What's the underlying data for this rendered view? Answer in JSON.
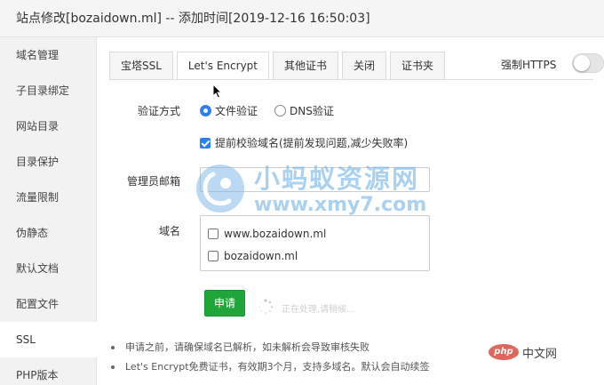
{
  "title": "站点修改[bozaidown.ml] -- 添加时间[2019-12-16 16:50:03]",
  "sidebar": {
    "items": [
      {
        "label": "域名管理"
      },
      {
        "label": "子目录绑定"
      },
      {
        "label": "网站目录"
      },
      {
        "label": "目录保护"
      },
      {
        "label": "流量限制"
      },
      {
        "label": "伪静态"
      },
      {
        "label": "默认文档"
      },
      {
        "label": "配置文件"
      },
      {
        "label": "SSL"
      },
      {
        "label": "PHP版本"
      }
    ],
    "active": "SSL"
  },
  "tabs": [
    {
      "label": "宝塔SSL"
    },
    {
      "label": "Let's Encrypt"
    },
    {
      "label": "其他证书"
    },
    {
      "label": "关闭"
    },
    {
      "label": "证书夹"
    }
  ],
  "active_tab": "Let's Encrypt",
  "force_https": {
    "label": "强制HTTPS",
    "enabled": false
  },
  "form": {
    "verify_label": "验证方式",
    "verify_options": [
      {
        "label": "文件验证",
        "selected": true
      },
      {
        "label": "DNS验证",
        "selected": false
      }
    ],
    "precheck": {
      "label": "提前校验域名(提前发现问题,减少失败率)",
      "checked": true
    },
    "email_label": "管理员邮箱",
    "email_value": "",
    "domain_label": "域名",
    "domains": [
      {
        "label": "www.bozaidown.ml",
        "checked": false
      },
      {
        "label": "bozaidown.ml",
        "checked": false
      }
    ],
    "apply_button": "申请",
    "loading_text": "正在处理,请稍候..."
  },
  "notes": [
    "申请之前，请确保域名已解析，如未解析会导致审核失败",
    "Let's Encrypt免费证书，有效期3个月，支持多域名。默认会自动续签"
  ],
  "watermark": {
    "title": "小蚂蚁资源网",
    "url": "www.xmy7.com"
  },
  "php_logo": {
    "badge": "php",
    "text": "中文网"
  },
  "colors": {
    "primary": "#2d7ff9",
    "apply_green": "#20a53a",
    "sidebar_bg": "#f2f2f2"
  }
}
